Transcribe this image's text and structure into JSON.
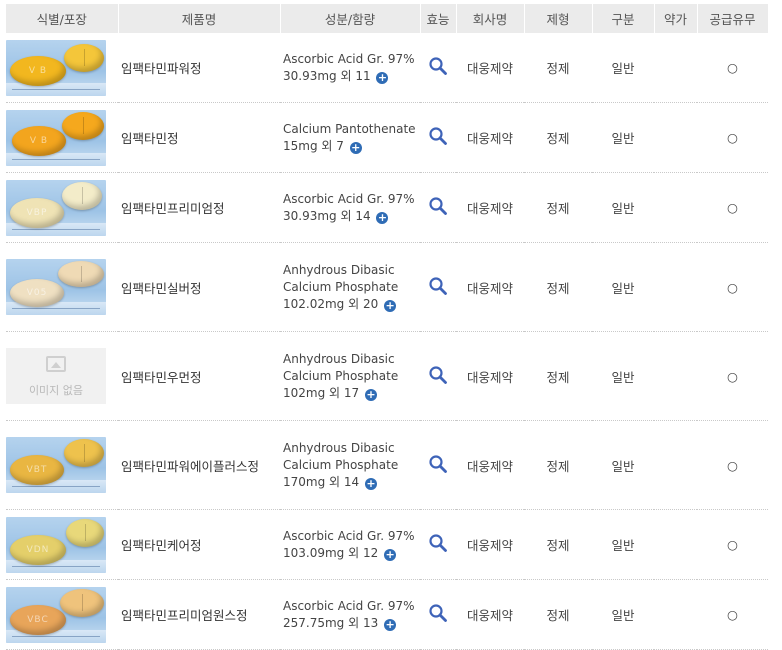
{
  "headers": {
    "image": "식별/포장",
    "name": "제품명",
    "ingredient": "성분/함량",
    "efficacy": "효능",
    "company": "회사명",
    "form": "제형",
    "category": "구분",
    "price": "약가",
    "supply": "공급유무"
  },
  "no_image_text": "이미지 없음",
  "icons": {
    "efficacy": "search-icon",
    "more": "plus-circle-icon",
    "supply": "circle-icon"
  },
  "colors": {
    "accent": "#2f6cb5",
    "magnifier": "#3e63b8",
    "header_bg": "#ebebeb"
  },
  "rows": [
    {
      "name": "임팩타민파워정",
      "ing1": "Ascorbic Acid Gr. 97%",
      "ing2": "",
      "ing3": "30.93mg 외 11",
      "company": "대웅제약",
      "form": "정제",
      "category": "일반",
      "price": "",
      "supply": "○",
      "pill_label": "V B"
    },
    {
      "name": "임팩타민정",
      "ing1": "Calcium Pantothenate",
      "ing2": "",
      "ing3": "15mg 외 7",
      "company": "대웅제약",
      "form": "정제",
      "category": "일반",
      "price": "",
      "supply": "○",
      "pill_label": "V B"
    },
    {
      "name": "임팩타민프리미엄정",
      "ing1": "Ascorbic Acid Gr. 97%",
      "ing2": "",
      "ing3": "30.93mg 외 14",
      "company": "대웅제약",
      "form": "정제",
      "category": "일반",
      "price": "",
      "supply": "○",
      "pill_label": "VBP"
    },
    {
      "name": "임팩타민실버정",
      "ing1": "Anhydrous Dibasic",
      "ing2": "Calcium Phosphate",
      "ing3": "102.02mg 외 20",
      "company": "대웅제약",
      "form": "정제",
      "category": "일반",
      "price": "",
      "supply": "○",
      "pill_label": "V05"
    },
    {
      "name": "임팩타민우먼정",
      "ing1": "Anhydrous Dibasic",
      "ing2": "Calcium Phosphate",
      "ing3": "102mg 외 17",
      "company": "대웅제약",
      "form": "정제",
      "category": "일반",
      "price": "",
      "supply": "○",
      "pill_label": ""
    },
    {
      "name": "임팩타민파워에이플러스정",
      "ing1": "Anhydrous Dibasic",
      "ing2": "Calcium Phosphate",
      "ing3": "170mg 외 14",
      "company": "대웅제약",
      "form": "정제",
      "category": "일반",
      "price": "",
      "supply": "○",
      "pill_label": "VBT"
    },
    {
      "name": "임팩타민케어정",
      "ing1": "Ascorbic Acid Gr. 97%",
      "ing2": "",
      "ing3": "103.09mg 외 12",
      "company": "대웅제약",
      "form": "정제",
      "category": "일반",
      "price": "",
      "supply": "○",
      "pill_label": "VDN"
    },
    {
      "name": "임팩타민프리미엄원스정",
      "ing1": "Ascorbic Acid Gr. 97%",
      "ing2": "",
      "ing3": "257.75mg 외 13",
      "company": "대웅제약",
      "form": "정제",
      "category": "일반",
      "price": "",
      "supply": "○",
      "pill_label": "VBC"
    }
  ]
}
